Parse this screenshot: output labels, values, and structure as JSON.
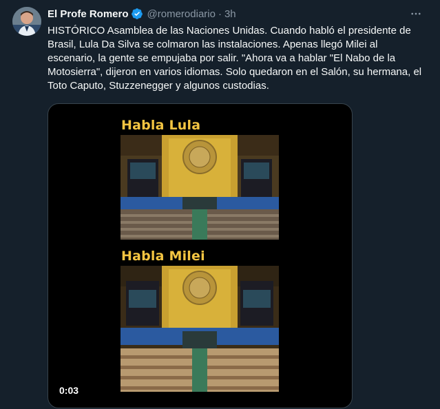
{
  "tweet": {
    "author_name": "El Profe Romero",
    "handle": "@romerodiario",
    "separator": "·",
    "time": "3h",
    "more_icon": "ellipsis-icon",
    "verified_icon": "verified-badge-icon",
    "body": "HISTÓRICO Asamblea de las Naciones Unidas. Cuando habló el presidente de Brasil, Lula Da Silva se colmaron las instalaciones. Apenas llegó Milei al escenario, la gente se empujaba por salir. \"Ahora va a hablar \"El Nabo de la Motosierra\", dijeron en varios idiomas. Solo quedaron en el Salón, su hermana, el Toto Caputo, Stuzzenegger y algunos custodias."
  },
  "media": {
    "caption_top": "Habla Lula",
    "caption_bottom": "Habla Milei",
    "duration": "0:03"
  },
  "colors": {
    "background": "#15202b",
    "caption": "#f4c542",
    "verified": "#1d9bf0"
  }
}
